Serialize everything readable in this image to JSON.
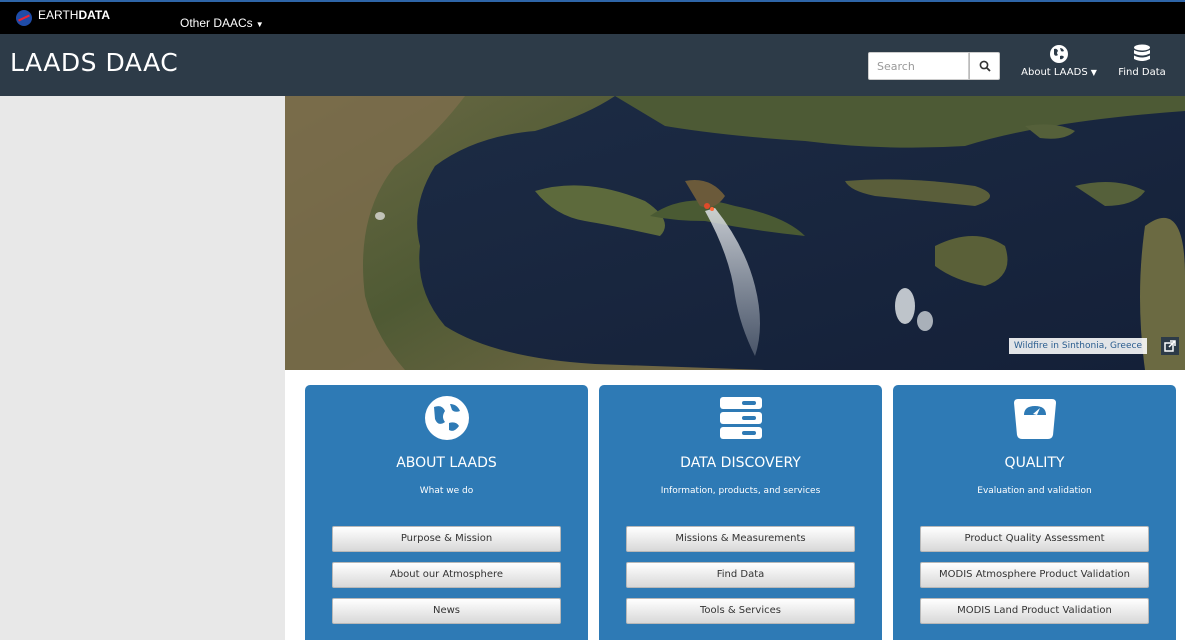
{
  "topbar": {
    "brand_light": "EARTH",
    "brand_bold": "DATA",
    "other_daacs": "Other DAACs"
  },
  "header": {
    "title": "LAADS DAAC",
    "search_placeholder": "Search",
    "nav_about": "About LAADS",
    "nav_find": "Find Data"
  },
  "hero": {
    "caption": "Wildfire in Sinthonia, Greece"
  },
  "cards": [
    {
      "title": "ABOUT LAADS",
      "subtitle": "What we do",
      "buttons": [
        "Purpose & Mission",
        "About our Atmosphere",
        "News"
      ]
    },
    {
      "title": "DATA DISCOVERY",
      "subtitle": "Information, products, and services",
      "buttons": [
        "Missions & Measurements",
        "Find Data",
        "Tools & Services"
      ]
    },
    {
      "title": "QUALITY",
      "subtitle": "Evaluation and validation",
      "buttons": [
        "Product Quality Assessment",
        "MODIS Atmosphere Product Validation",
        "MODIS Land Product Validation"
      ]
    }
  ],
  "colors": {
    "topbar": "#000000",
    "header": "#2d3b48",
    "card": "#2e7ab5",
    "sidebar": "#e8e8e8"
  }
}
